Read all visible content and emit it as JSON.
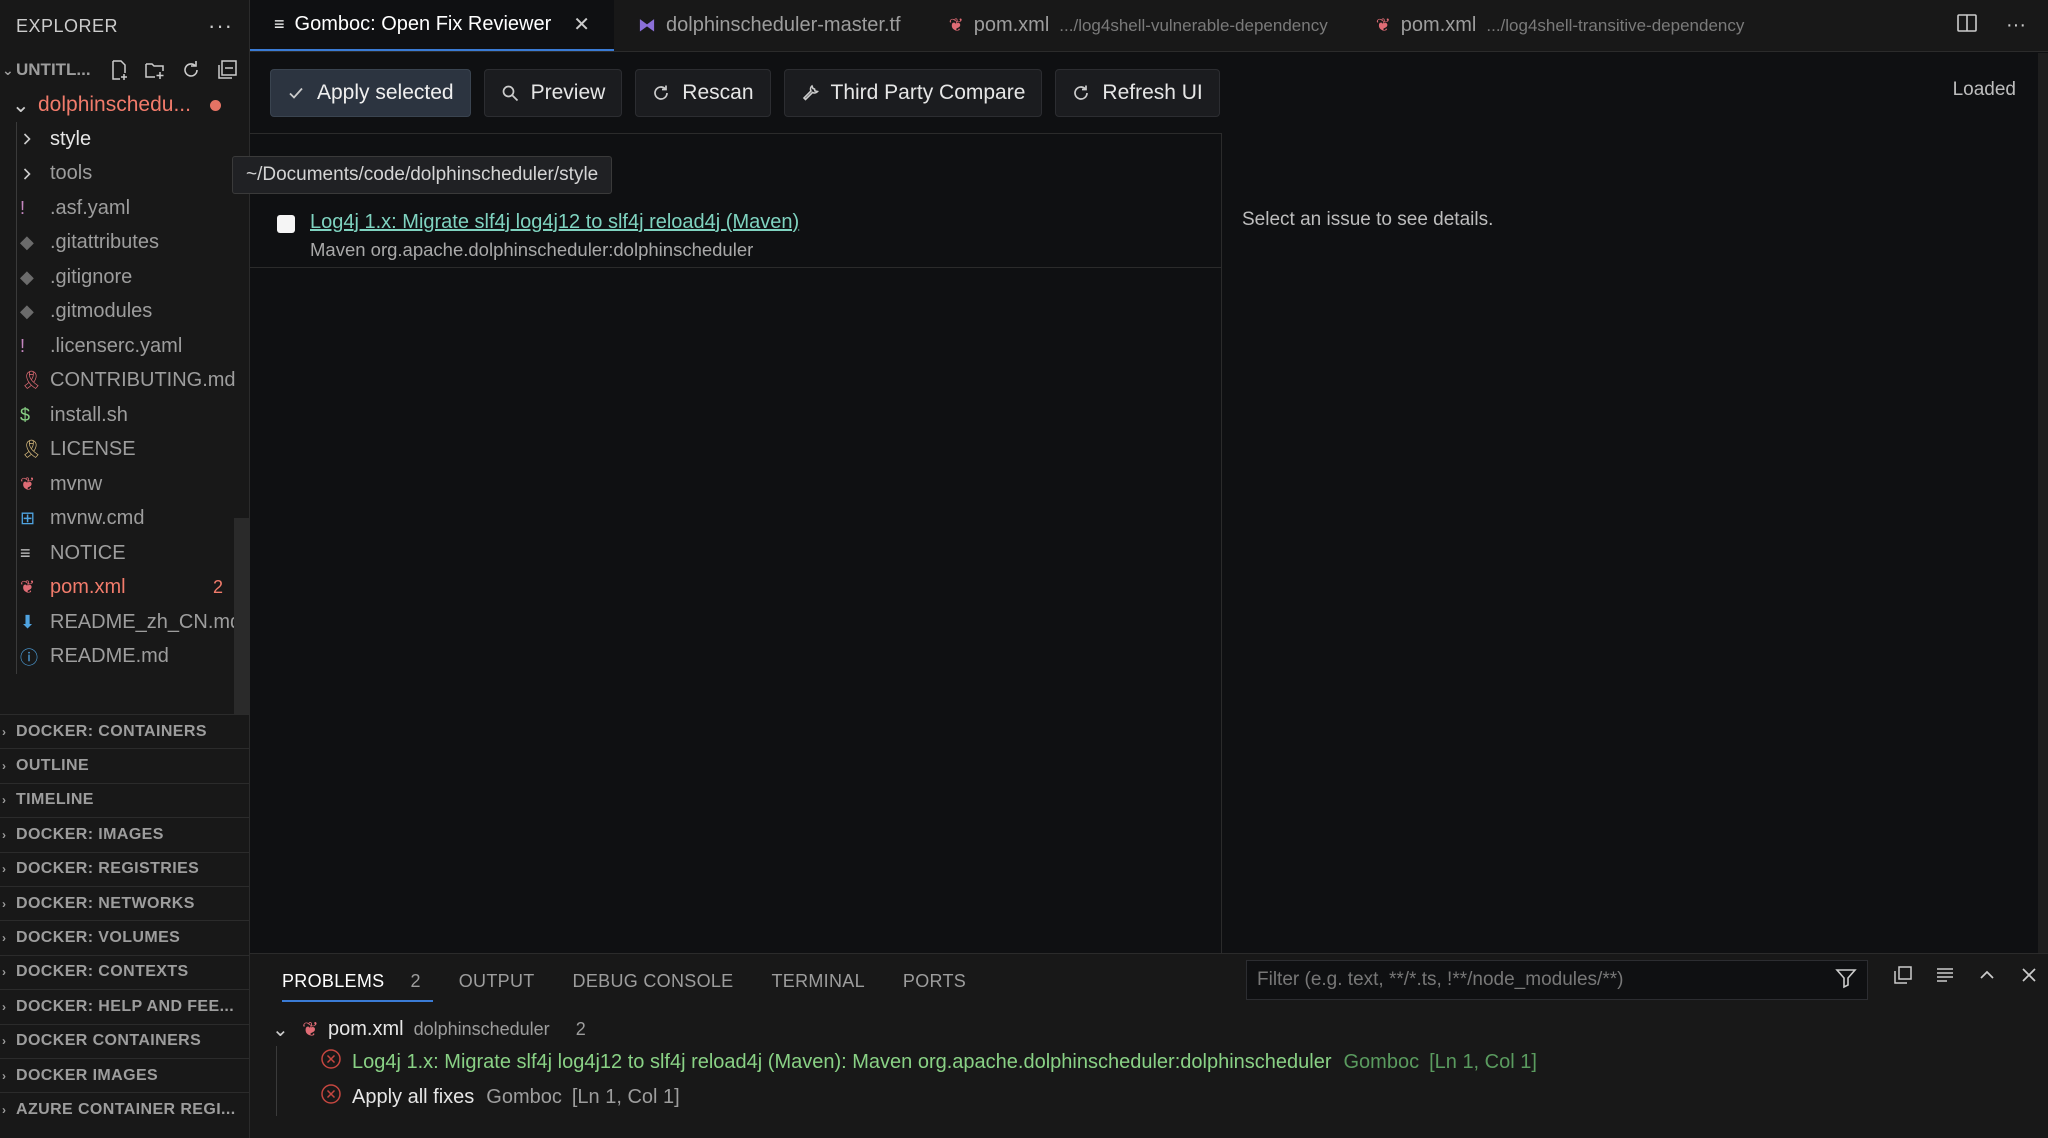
{
  "sidebar": {
    "title": "EXPLORER",
    "more": "···",
    "workspace": "UNTITL...",
    "root_folder": "dolphinschedu...",
    "items": [
      {
        "label": "style",
        "kind": "folder",
        "icon": "chevron-right-icon"
      },
      {
        "label": "tools",
        "kind": "folder",
        "icon": "chevron-right-icon"
      },
      {
        "label": ".asf.yaml",
        "kind": "file",
        "icon": "exclamation-icon",
        "glyph": "!",
        "color": "#c586c0"
      },
      {
        "label": ".gitattributes",
        "kind": "file",
        "icon": "git-icon",
        "glyph": "◆",
        "color": "#6b6b6b"
      },
      {
        "label": ".gitignore",
        "kind": "file",
        "icon": "git-icon",
        "glyph": "◆",
        "color": "#6b6b6b"
      },
      {
        "label": ".gitmodules",
        "kind": "file",
        "icon": "git-icon",
        "glyph": "◆",
        "color": "#6b6b6b"
      },
      {
        "label": ".licenserc.yaml",
        "kind": "file",
        "icon": "exclamation-icon",
        "glyph": "!",
        "color": "#c586c0"
      },
      {
        "label": "CONTRIBUTING.md",
        "kind": "file",
        "icon": "ribbon-icon",
        "glyph": "🎗",
        "color": "#e06c75"
      },
      {
        "label": "install.sh",
        "kind": "file",
        "icon": "dollar-icon",
        "glyph": "$",
        "color": "#89d185"
      },
      {
        "label": "LICENSE",
        "kind": "file",
        "icon": "license-icon",
        "glyph": "🎗",
        "color": "#d7ba7d"
      },
      {
        "label": "mvnw",
        "kind": "file",
        "icon": "maven-icon",
        "glyph": "❦",
        "color": "#e06c75"
      },
      {
        "label": "mvnw.cmd",
        "kind": "file",
        "icon": "windows-icon",
        "glyph": "⊞",
        "color": "#4fa3e0"
      },
      {
        "label": "NOTICE",
        "kind": "file",
        "icon": "lines-icon",
        "glyph": "≡",
        "color": "#cccccc"
      },
      {
        "label": "pom.xml",
        "kind": "file",
        "icon": "maven-icon",
        "glyph": "❦",
        "color": "#e06c75",
        "badge": "2",
        "error": true
      },
      {
        "label": "README_zh_CN.md",
        "kind": "file",
        "icon": "download-icon",
        "glyph": "⬇",
        "color": "#4fa3e0"
      },
      {
        "label": "README.md",
        "kind": "file",
        "icon": "info-icon",
        "glyph": "ⓘ",
        "color": "#4fa3e0"
      }
    ],
    "panels": [
      "DOCKER: CONTAINERS",
      "OUTLINE",
      "TIMELINE",
      "DOCKER: IMAGES",
      "DOCKER: REGISTRIES",
      "DOCKER: NETWORKS",
      "DOCKER: VOLUMES",
      "DOCKER: CONTEXTS",
      "DOCKER: HELP AND FEE...",
      "DOCKER CONTAINERS",
      "DOCKER IMAGES",
      "AZURE CONTAINER REGI..."
    ]
  },
  "tabs": [
    {
      "label": "Gomboc: Open Fix Reviewer",
      "desc": "",
      "active": true,
      "icon": "preview-icon",
      "glyph": "≡"
    },
    {
      "label": "dolphinscheduler-master.tf",
      "desc": "",
      "active": false,
      "icon": "terraform-icon",
      "glyph": "⧓",
      "color": "#8b6fd8"
    },
    {
      "label": "pom.xml",
      "desc": ".../log4shell-vulnerable-dependency",
      "active": false,
      "icon": "maven-icon",
      "glyph": "❦",
      "color": "#e06c75"
    },
    {
      "label": "pom.xml",
      "desc": ".../log4shell-transitive-dependency",
      "active": false,
      "icon": "maven-icon",
      "glyph": "❦",
      "color": "#e06c75"
    }
  ],
  "toolbar": {
    "apply": "Apply selected",
    "preview": "Preview",
    "rescan": "Rescan",
    "compare": "Third Party Compare",
    "refresh": "Refresh UI",
    "status": "Loaded"
  },
  "tooltip": "~/Documents/code/dolphinscheduler/style",
  "issues": [
    {
      "title": "Log4j 1.x: Migrate slf4j log4j12 to slf4j reload4j (Maven)",
      "subtitle": "Maven org.apache.dolphinscheduler:dolphinscheduler",
      "checked": false
    }
  ],
  "detail": {
    "hint": "Select an issue to see details."
  },
  "panel": {
    "tabs": [
      {
        "label": "PROBLEMS",
        "count": "2",
        "active": true
      },
      {
        "label": "OUTPUT",
        "active": false
      },
      {
        "label": "DEBUG CONSOLE",
        "active": false
      },
      {
        "label": "TERMINAL",
        "active": false
      },
      {
        "label": "PORTS",
        "active": false
      }
    ],
    "filter_placeholder": "Filter (e.g. text, **/*.ts, !**/node_modules/**)",
    "group": {
      "file": "pom.xml",
      "dir": "dolphinscheduler",
      "count": "2"
    },
    "problems": [
      {
        "message": "Log4j 1.x: Migrate slf4j log4j12 to slf4j reload4j (Maven): Maven org.apache.dolphinscheduler:dolphinscheduler",
        "source": "Gomboc",
        "location": "[Ln 1, Col 1]",
        "highlight": true
      },
      {
        "message": "Apply all fixes",
        "source": "Gomboc",
        "location": "[Ln 1, Col 1]",
        "highlight": false
      }
    ]
  },
  "colors": {
    "accent": "#3a7bd5",
    "error": "#f17b6b",
    "link": "#7fd3c0",
    "success": "#89d185"
  }
}
